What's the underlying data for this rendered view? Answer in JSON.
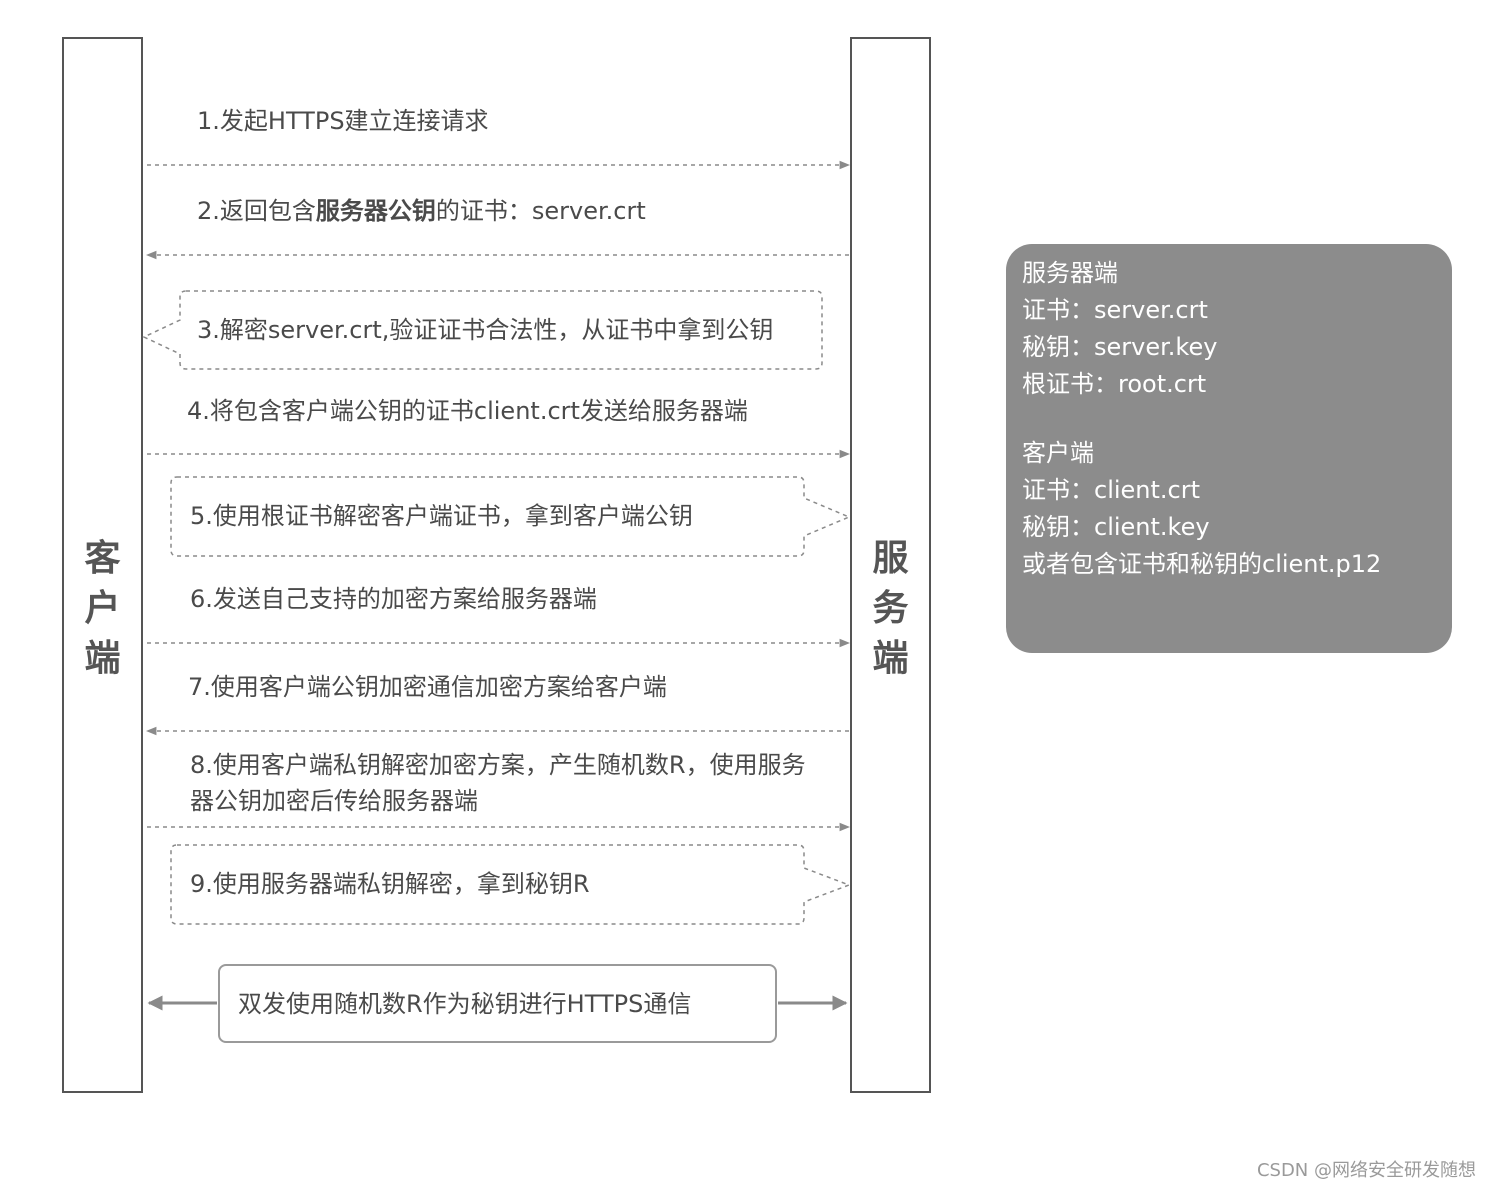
{
  "client_label": "客\n户\n端",
  "server_label": "服\n务\n端",
  "steps": {
    "s1": "1.发起HTTPS建立连接请求",
    "s2_pre": "2.返回包含",
    "s2_bold": "服务器公钥",
    "s2_post": "的证书：server.crt",
    "s3": "3.解密server.crt,验证证书合法性，从证书中拿到公钥",
    "s4": "4.将包含客户端公钥的证书client.crt发送给服务器端",
    "s5": "5.使用根证书解密客户端证书，拿到客户端公钥",
    "s6": "6.发送自己支持的加密方案给服务器端",
    "s7": "7.使用客户端公钥加密通信加密方案给客户端",
    "s8": "8.使用客户端私钥解密加密方案，产生随机数R，使用服务器公钥加密后传给服务器端",
    "s9": "9.使用服务器端私钥解密，拿到秘钥R"
  },
  "final_message": "双发使用随机数R作为秘钥进行HTTPS通信",
  "info_panel": {
    "server_title": "服务器端",
    "server_cert": "证书：server.crt",
    "server_key": "秘钥：server.key",
    "server_root": "根证书：root.crt",
    "client_title": "客户端",
    "client_cert": "证书：client.crt",
    "client_key": "秘钥：client.key",
    "client_p12": "或者包含证书和秘钥的client.p12"
  },
  "watermark": "CSDN @网络安全研发随想",
  "colors": {
    "line": "#555555",
    "dashed": "#8a8a8a",
    "panel": "#8c8c8c",
    "panel_text": "#ffffff"
  }
}
